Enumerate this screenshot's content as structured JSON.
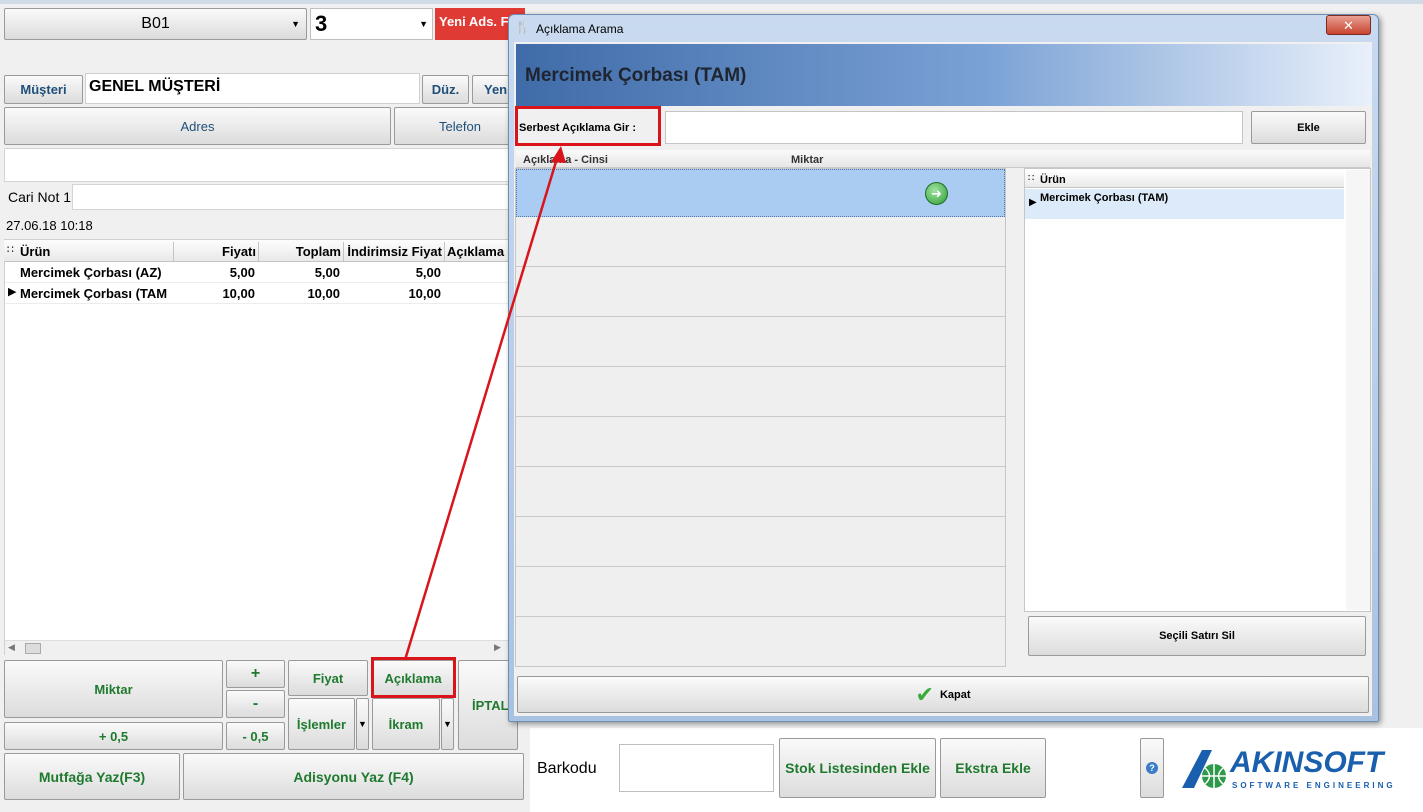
{
  "top": {
    "table_combo": "B01",
    "count_combo": "3",
    "new_ads_button": "Yeni Ads. F"
  },
  "customer": {
    "label": "Müşteri",
    "name": "GENEL MÜŞTERİ",
    "edit_button": "Düz.",
    "new_button": "Yen",
    "address_button": "Adres",
    "phone_button": "Telefon",
    "cari_not_label": "Cari Not 1",
    "datetime": "27.06.18 10:18"
  },
  "order_grid": {
    "columns": [
      "Ürün",
      "Fiyatı",
      "Toplam",
      "İndirimsiz Fiyat",
      "Açıklama"
    ],
    "rows": [
      {
        "urun": "Mercimek Çorbası (AZ)",
        "fiyat": "5,00",
        "toplam": "5,00",
        "indirimsiz": "5,00"
      },
      {
        "urun": "Mercimek Çorbası (TAM",
        "fiyat": "10,00",
        "toplam": "10,00",
        "indirimsiz": "10,00"
      }
    ]
  },
  "actions": {
    "miktar": "Miktar",
    "plus": "+",
    "minus": "-",
    "plus_half": "+ 0,5",
    "minus_half": "- 0,5",
    "fiyat": "Fiyat",
    "aciklama": "Açıklama",
    "islemler": "İşlemler",
    "ikram": "İkram",
    "iptal": "İPTAL",
    "mutfaga_yaz": "Mutfağa Yaz(F3)",
    "adisyonu_yaz": "Adisyonu Yaz (F4)"
  },
  "bottom_bar": {
    "barkodu_label": "Barkodu",
    "stok_button": "Stok Listesinden Ekle",
    "ekstra_button": "Ekstra Ekle",
    "logo_text": "AKINSOFT",
    "logo_subtext": "SOFTWARE ENGINEERING"
  },
  "dialog": {
    "window_title": "Açıklama Arama",
    "product_title": "Mercimek Çorbası (TAM)",
    "free_text_label": "Serbest Açıklama Gir :",
    "add_button": "Ekle",
    "col_aciklama": "Açıklama - Cinsi",
    "col_miktar": "Miktar",
    "right_grid_header": "Ürün",
    "right_grid_row": "Mercimek Çorbası (TAM)",
    "delete_button": "Seçili Satırı Sil",
    "close_button": "Kapat"
  },
  "colors": {
    "action_green": "#1f7a2e",
    "new_ads_red": "#e03a35",
    "annotation_red": "#d9141a",
    "selected_row": "#aacbf2",
    "logo_blue": "#1a5fae"
  }
}
